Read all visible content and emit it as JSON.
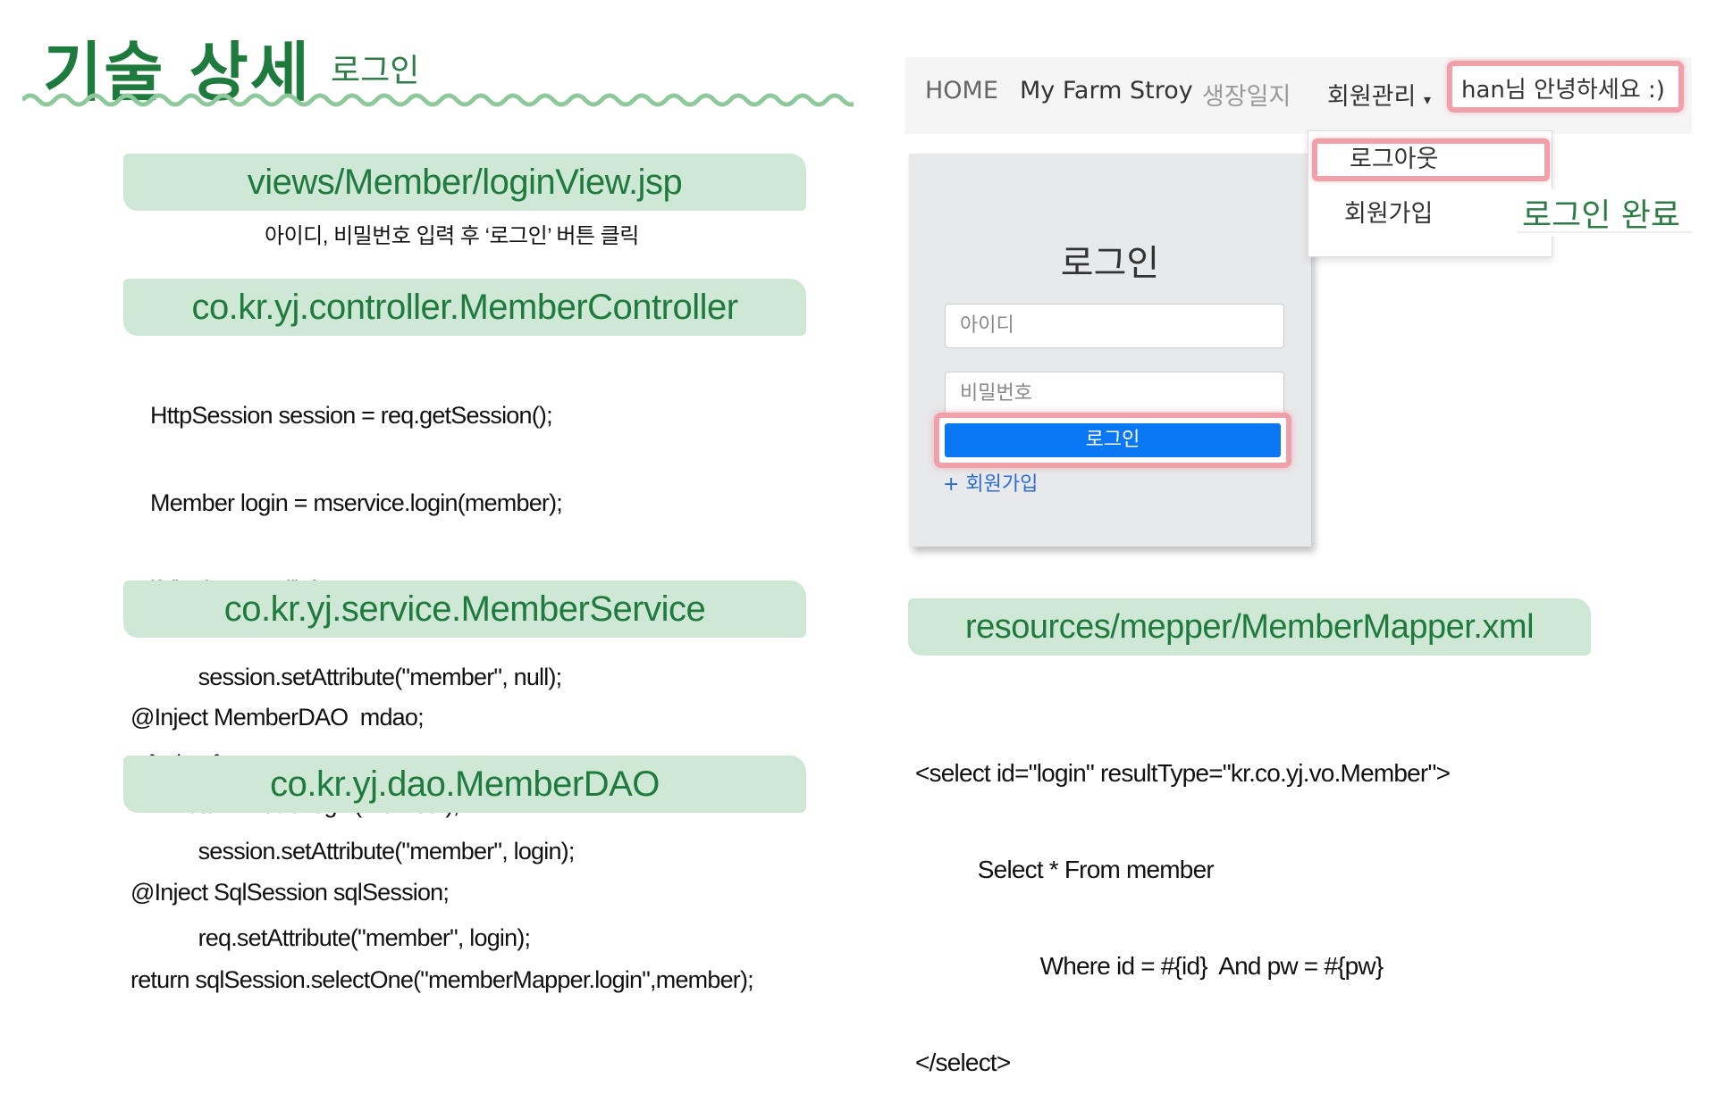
{
  "header": {
    "title": "기술 상세",
    "subtitle": "로그인"
  },
  "sections": {
    "view": {
      "banner": "views/Member/loginView.jsp",
      "note": "아이디, 비밀번호 입력 후 ‘로그인’ 버튼 클릭"
    },
    "controller": {
      "banner": "co.kr.yj.controller.MemberController",
      "code": [
        "HttpSession session = req.getSession();",
        "Member login = mservice.login(member);",
        "if (login == null) {",
        "        session.setAttribute(\"member\", null);",
        "} else {",
        "        session.setAttribute(\"member\", login);",
        "        req.setAttribute(\"member\", login);"
      ]
    },
    "service": {
      "banner": "co.kr.yj.service.MemberService",
      "code": [
        "@Inject MemberDAO  mdao;",
        "        return mdao.login(member);"
      ]
    },
    "dao": {
      "banner": "co.kr.yj.dao.MemberDAO",
      "code": [
        "@Inject SqlSession sqlSession;",
        "return sqlSession.selectOne(\"memberMapper.login\",member);"
      ]
    },
    "mapper": {
      "banner": "resources/mepper/MemberMapper.xml",
      "code": [
        "<select id=\"login\" resultType=\"kr.co.yj.vo.Member\">",
        "          Select * From member",
        "                    Where id = #{id}  And pw = #{pw}",
        "</select>"
      ]
    }
  },
  "screenshot": {
    "nav": {
      "home": "HOME",
      "farm": "My Farm Stroy",
      "diary": "생장일지",
      "member": "회원관리",
      "greeting": "han님 안녕하세요 :)"
    },
    "dropdown": {
      "logout": "로그아웃",
      "join": "회원가입"
    },
    "done_label": "로그인 완료",
    "login_form": {
      "heading": "로그인",
      "id_placeholder": "아이디",
      "pw_placeholder": "비밀번호",
      "submit": "로그인",
      "join_link": "+ 회원가입"
    }
  },
  "colors": {
    "accent_green": "#1f7a3e",
    "banner_bg": "#cfe8d6",
    "highlight": "#f0a0a8",
    "button_blue": "#0a78f5"
  }
}
